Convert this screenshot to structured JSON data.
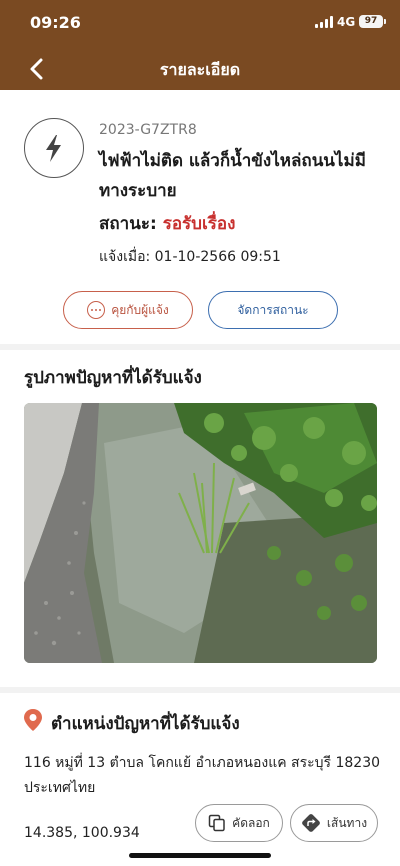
{
  "status_bar": {
    "time": "09:26",
    "network": "4G",
    "battery": "97"
  },
  "nav": {
    "title": "รายละเอียด",
    "back_icon": "chevron-left-icon"
  },
  "report": {
    "case_id": "2023-G7ZTR8",
    "title": "ไฟฟ้าไม่ติด แล้วก็น้ำขังไหล่ถนนไม่มีทางระบาย",
    "category_icon": "lightning-icon",
    "status_label": "สถานะ:",
    "status_value": "รอรับเรื่อง",
    "reported_at": "แจ้งเมื่อ: 01-10-2566 09:51"
  },
  "actions": {
    "chat_label": "คุยกับผู้แจ้ง",
    "manage_label": "จัดการสถานะ"
  },
  "photos": {
    "heading": "รูปภาพปัญหาที่ได้รับแจ้ง"
  },
  "location": {
    "heading": "ตำแหน่งปัญหาที่ได้รับแจ้ง",
    "address": "116 หมู่ที่ 13 ตำบล โคกแย้ อำเภอหนองแค สระบุรี 18230 ประเทศไทย",
    "coords": "14.385, 100.934",
    "copy_label": "คัดลอก",
    "route_label": "เส้นทาง"
  },
  "colors": {
    "brand_brown": "#7a4a22",
    "status_red": "#c8312f",
    "chat_accent": "#c7604b",
    "manage_accent": "#3d6fb0",
    "pin_color": "#e06a4e"
  }
}
